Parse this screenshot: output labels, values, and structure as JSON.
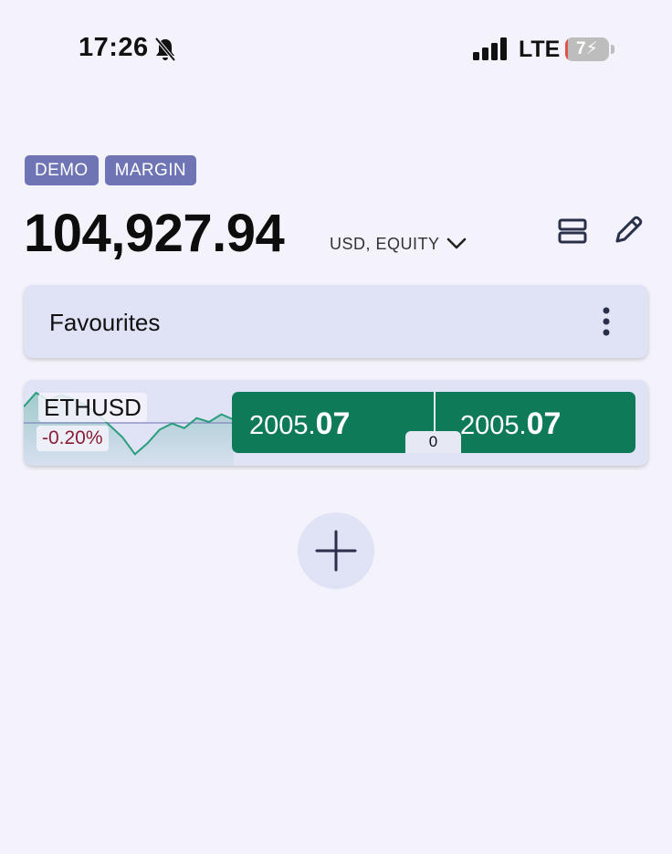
{
  "status_bar": {
    "time": "17:26",
    "network": "LTE",
    "battery_level": "7",
    "battery_fraction": 0.07,
    "icons": [
      "bell-muted-icon",
      "signal-icon",
      "battery-charging-icon"
    ]
  },
  "account": {
    "badges": [
      "DEMO",
      "MARGIN"
    ],
    "balance": "104,927.94",
    "balance_unit": "USD, EQUITY",
    "icons": [
      "chevron-down-icon",
      "view-layout-icon",
      "edit-pencil-icon"
    ]
  },
  "watchlist": {
    "title": "Favourites",
    "menu_icon": "more-vertical-icon"
  },
  "instruments": [
    {
      "symbol": "ETHUSD",
      "change": "-0.20%",
      "sell": {
        "main": "2005.",
        "big": "07"
      },
      "buy": {
        "main": "2005.",
        "big": "07"
      },
      "spread": "0",
      "sparkline": [
        0.3,
        0.12,
        0.22,
        0.15,
        0.2,
        0.28,
        0.4,
        0.55,
        0.7,
        0.92,
        0.78,
        0.6,
        0.52,
        0.58,
        0.45,
        0.5,
        0.4,
        0.47
      ]
    }
  ],
  "add_button": {
    "icon": "plus-icon"
  },
  "colors": {
    "background": "#f4f3fb",
    "badge": "#6f75b4",
    "card": "#e0e3f5",
    "price_box": "#0e7a58",
    "negative": "#8a1d33",
    "sparkline": "#2a9d7f"
  }
}
